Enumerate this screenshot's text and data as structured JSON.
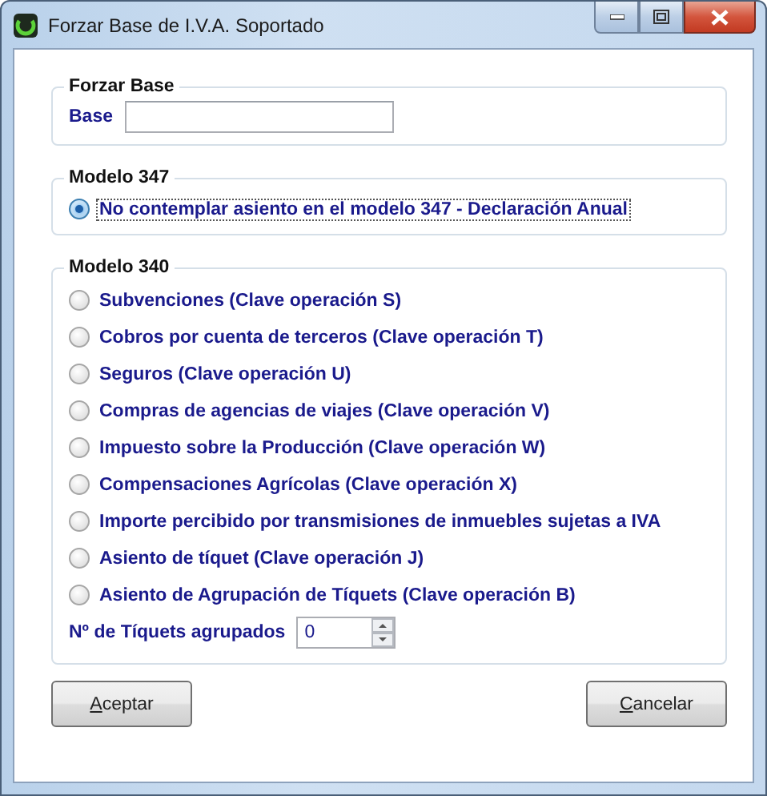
{
  "window": {
    "title": "Forzar Base de I.V.A. Soportado"
  },
  "forzar_base": {
    "title": "Forzar Base",
    "base_field": {
      "label": "Base"
    }
  },
  "modelo_347": {
    "title": "Modelo 347",
    "options": [
      {
        "label": "No contemplar asiento en el modelo 347 - Declaración Anual",
        "selected": true,
        "focused": true
      }
    ]
  },
  "modelo_340": {
    "title": "Modelo 340",
    "options": [
      {
        "label": "Subvenciones (Clave operación S)",
        "selected": false,
        "focused": false
      },
      {
        "label": "Cobros por cuenta de terceros (Clave operación T)",
        "selected": false,
        "focused": false
      },
      {
        "label": "Seguros (Clave operación U)",
        "selected": false,
        "focused": false
      },
      {
        "label": "Compras de agencias de viajes (Clave operación V)",
        "selected": false,
        "focused": false
      },
      {
        "label": "Impuesto sobre la Producción (Clave operación W)",
        "selected": false,
        "focused": false
      },
      {
        "label": "Compensaciones Agrícolas (Clave operación X)",
        "selected": false,
        "focused": false
      },
      {
        "label": "Importe percibido por transmisiones de inmuebles sujetas a IVA",
        "selected": false,
        "focused": false
      },
      {
        "label": "Asiento de tíquet (Clave operación J)",
        "selected": false,
        "focused": false
      },
      {
        "label": "Asiento de Agrupación de Tíquets (Clave operación B)",
        "selected": false,
        "focused": false
      }
    ],
    "tiquets_field": {
      "label": "Nº de Tíquets agrupados",
      "value": "0"
    }
  },
  "buttons": [
    {
      "label": "Aceptar",
      "mnemonic": true
    },
    {
      "label": "Cancelar",
      "mnemonic": true
    }
  ]
}
